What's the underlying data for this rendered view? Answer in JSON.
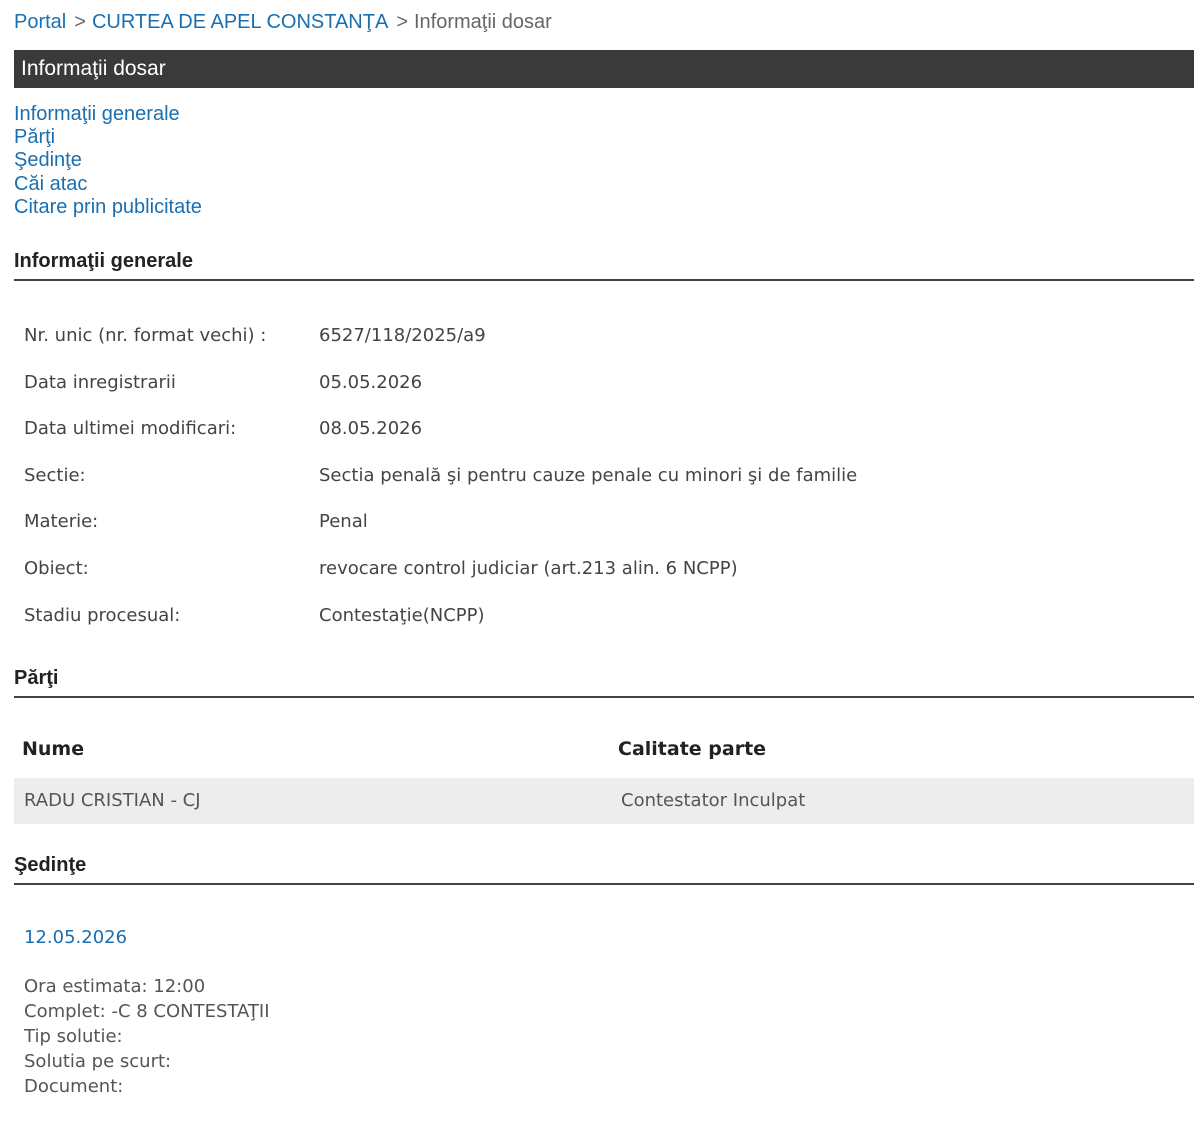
{
  "breadcrumb": {
    "portal": "Portal",
    "court": "CURTEA DE APEL CONSTANŢA",
    "current": "Informaţii dosar",
    "separator": ">"
  },
  "title_bar": "Informaţii dosar",
  "anchor_nav": [
    "Informaţii generale",
    "Părţi",
    "Şedinţe",
    "Căi atac",
    "Citare prin publicitate"
  ],
  "general": {
    "heading": "Informaţii generale",
    "rows": [
      {
        "label": "Nr. unic (nr. format vechi) :",
        "value": "6527/118/2025/a9"
      },
      {
        "label": "Data inregistrarii",
        "value": "05.05.2026"
      },
      {
        "label": "Data ultimei modificari:",
        "value": "08.05.2026"
      },
      {
        "label": "Sectie:",
        "value": "Sectia penală şi pentru cauze penale cu minori şi de familie"
      },
      {
        "label": "Materie:",
        "value": "Penal"
      },
      {
        "label": "Obiect:",
        "value": "revocare control judiciar (art.213 alin. 6 NCPP)"
      },
      {
        "label": "Stadiu procesual:",
        "value": "Contestaţie(NCPP)"
      }
    ]
  },
  "parti": {
    "heading": "Părţi",
    "col_name": "Nume",
    "col_role": "Calitate parte",
    "rows": [
      {
        "name": "RADU CRISTIAN - CJ",
        "role": "Contestator Inculpat"
      }
    ]
  },
  "sedinte": {
    "heading": "Şedinţe",
    "date": "12.05.2026",
    "details": [
      "Ora estimata: 12:00",
      "Complet: -C 8 CONTESTAŢII",
      "Tip solutie:",
      "Solutia pe scurt:",
      "Document:"
    ]
  },
  "colors": {
    "link": "#1a6fb0",
    "title_bar_bg": "#3a3a3a",
    "row_bg": "#ededed"
  }
}
